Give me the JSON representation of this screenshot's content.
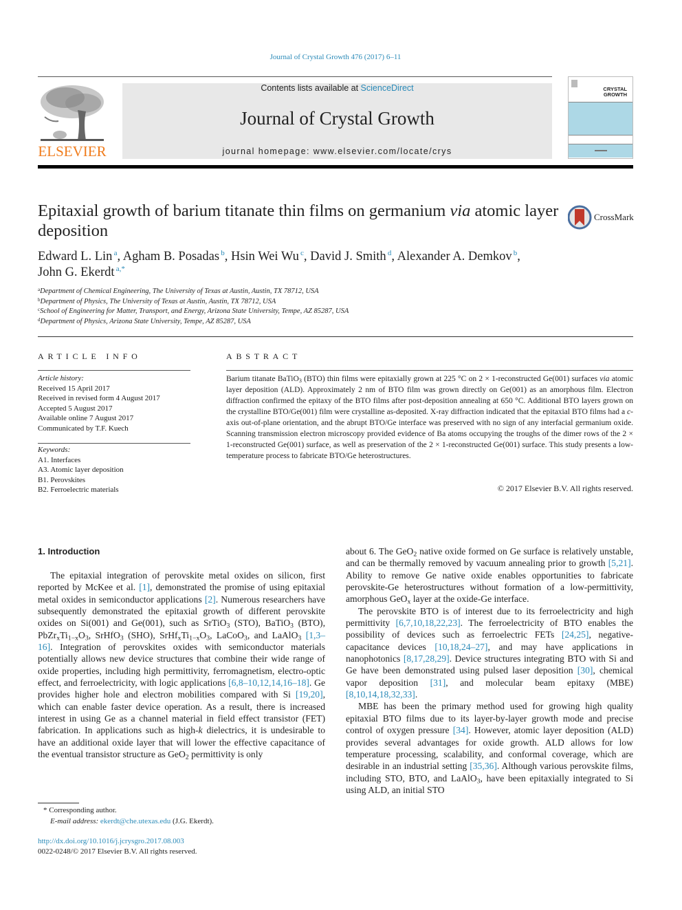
{
  "running_head": "Journal of Crystal Growth 476 (2017) 6–11",
  "header": {
    "publisher_logo": "ELSEVIER",
    "contents_prefix": "Contents lists available at ",
    "contents_link": "ScienceDirect",
    "journal_name": "Journal of Crystal Growth",
    "homepage": "journal homepage: www.elsevier.com/locate/crys",
    "cover_title_line1": "CRYSTAL",
    "cover_title_line2": "GROWTH",
    "colors": {
      "link": "#2a8ab8",
      "elsevier_orange": "#f07c1c",
      "masthead_bg": "#e8e8e8",
      "cover_blue": "#add8e6"
    }
  },
  "article": {
    "title_part1": "Epitaxial growth of barium titanate thin films on germanium ",
    "title_italic": "via",
    "title_part2": " atomic layer deposition",
    "crossmark_label": "CrossMark",
    "authors": [
      {
        "name": "Edward L. Lin",
        "sup": "a",
        "sep": ", "
      },
      {
        "name": "Agham B. Posadas",
        "sup": "b",
        "sep": ", "
      },
      {
        "name": "Hsin Wei Wu",
        "sup": "c",
        "sep": ", "
      },
      {
        "name": "David J. Smith",
        "sup": "d",
        "sep": ", "
      },
      {
        "name": "Alexander A. Demkov",
        "sup": "b",
        "sep": ", "
      },
      {
        "name": "John G. Ekerdt",
        "sup": "a,*",
        "sep": ""
      }
    ],
    "affiliations": [
      {
        "key": "a",
        "text": "Department of Chemical Engineering, The University of Texas at Austin, Austin, TX 78712, USA"
      },
      {
        "key": "b",
        "text": "Department of Physics, The University of Texas at Austin, Austin, TX 78712, USA"
      },
      {
        "key": "c",
        "text": "School of Engineering for Matter, Transport, and Energy, Arizona State University, Tempe, AZ 85287, USA"
      },
      {
        "key": "d",
        "text": "Department of Physics, Arizona State University, Tempe, AZ 85287, USA"
      }
    ]
  },
  "article_info": {
    "heading": "ARTICLE INFO",
    "history_label": "Article history:",
    "history": [
      "Received 15 April 2017",
      "Received in revised form 4 August 2017",
      "Accepted 5 August 2017",
      "Available online 7 August 2017",
      "Communicated by T.F. Kuech"
    ],
    "keywords_label": "Keywords:",
    "keywords": [
      "A1. Interfaces",
      "A3. Atomic layer deposition",
      "B1. Perovskites",
      "B2. Ferroelectric materials"
    ]
  },
  "abstract": {
    "heading": "ABSTRACT",
    "s1a": "Barium titanate BaTiO",
    "s1b": " (BTO) thin films were epitaxially grown at 225 °C on 2 × 1-reconstructed Ge(001) surfaces ",
    "s1c": " atomic layer deposition (ALD). Approximately 2 nm of BTO film was grown directly on Ge(001) as an amorphous film. Electron diffraction confirmed the epitaxy of the BTO films after post-deposition annealing at 650 °C. Additional BTO layers grown on the crystalline BTO/Ge(001) film were crystalline as-deposited. X-ray diffraction indicated that the epitaxial BTO films had a ",
    "s1d": "-axis out-of-plane orientation, and the abrupt BTO/Ge interface was preserved with no sign of any interfacial germanium oxide. Scanning transmission electron microscopy provided evidence of Ba atoms occupying the troughs of the dimer rows of the 2 × 1-reconstructed Ge(001) surface, as well as preservation of the 2 × 1-reconstructed Ge(001) surface. This study presents a low-temperature process to fabricate BTO/Ge heterostructures.",
    "via": "via",
    "c": "c",
    "sub3": "3",
    "copyright": "© 2017 Elsevier B.V. All rights reserved."
  },
  "introduction": {
    "heading": "1. Introduction",
    "p1": {
      "t1": "The epitaxial integration of perovskite metal oxides on silicon, first reported by McKee et al. ",
      "r1": "[1]",
      "t2": ", demonstrated the promise of using epitaxial metal oxides in semiconductor applications ",
      "r2": "[2]",
      "t3": ". Numerous researchers have subsequently demonstrated the epitaxial growth of different perovskite oxides on Si(001) and Ge(001), such as SrTiO",
      "t4": " (STO), BaTiO",
      "t5": " (BTO), PbZr",
      "t6": "Ti",
      "t7": "O",
      "t8": ", SrHfO",
      "t9": " (SHO), SrHf",
      "t10": "Ti",
      "t11": "O",
      "t12": ", LaCoO",
      "t13": ", and LaAlO",
      "t14": " ",
      "r3": "[1,3–16]",
      "t15": ". Integration of perovskites oxides with semiconductor materials potentially allows new device structures that combine their wide range of oxide properties, including high permittivity, ferromagnetism, electro-optic effect, and ferroelectricity, with logic applications ",
      "r4": "[6,8–10,12,14,16–18]",
      "t16": ". Ge provides higher hole and electron mobilities compared with Si ",
      "r5": "[19,20]",
      "t17": ", which can enable faster device operation. As a result, there is increased interest in using Ge as a channel material in field effect transistor (FET) fabrication. In applications such as high-",
      "k": "k",
      "t18": " dielectrics, it is undesirable to have an additional oxide layer that will lower the effective capacitance of the eventual transistor structure as GeO",
      "t19": " permittivity is only about 6. The GeO",
      "t20": " native oxide formed on Ge surface is relatively unstable, and can be thermally removed by vacuum annealing prior to growth ",
      "r6": "[5,21]",
      "t21": ". Ability to remove Ge native oxide enables opportunities to fabricate perovskite-Ge heterostructures without formation of a low-permittivity, amorphous GeO",
      "t22": " layer at the oxide-Ge interface.",
      "sub_x": "x",
      "sub_1x": "1−x",
      "sub_3": "3",
      "sub_2": "2"
    },
    "p2": {
      "t1": "The perovskite BTO is of interest due to its ferroelectricity and high permittivity ",
      "r1": "[6,7,10,18,22,23]",
      "t2": ". The ferroelectricity of BTO enables the possibility of devices such as ferroelectric FETs ",
      "r2": "[24,25]",
      "t3": ", negative-capacitance devices ",
      "r3": "[10,18,24–27]",
      "t4": ", and may have applications in nanophotonics ",
      "r4": "[8,17,28,29]",
      "t5": ". Device structures integrating BTO with Si and Ge have been demonstrated using pulsed laser deposition ",
      "r5": "[30]",
      "t6": ", chemical vapor deposition ",
      "r6": "[31]",
      "t7": ", and molecular beam epitaxy (MBE) ",
      "r7": "[8,10,14,18,32,33]",
      "t8": "."
    },
    "p3": {
      "t1": "MBE has been the primary method used for growing high quality epitaxial BTO films due to its layer-by-layer growth mode and precise control of oxygen pressure ",
      "r1": "[34]",
      "t2": ". However, atomic layer deposition (ALD) provides several advantages for oxide growth. ALD allows for low temperature processing, scalability, and conformal coverage, which are desirable in an industrial setting ",
      "r2": "[35,36]",
      "t3": ". Although various perovskite films, including STO, BTO, and LaAlO",
      "t4": ", have been epitaxially integrated to Si using ALD, an initial STO"
    }
  },
  "footnotes": {
    "corresponding": "* Corresponding author.",
    "email_label": "E-mail address: ",
    "email": "ekerdt@che.utexas.edu",
    "email_suffix": " (J.G. Ekerdt).",
    "doi": "http://dx.doi.org/10.1016/j.jcrysgro.2017.08.003",
    "issn": "0022-0248/© 2017 Elsevier B.V. All rights reserved."
  }
}
